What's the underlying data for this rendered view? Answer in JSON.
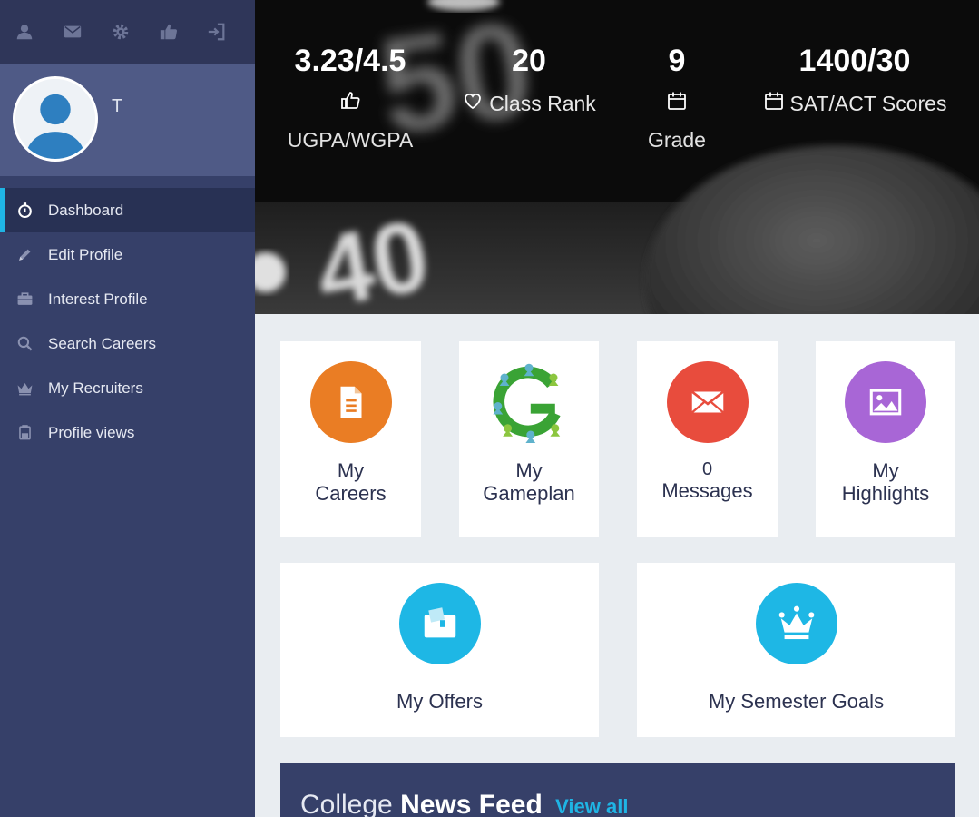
{
  "sidebar": {
    "top_icons": [
      "user-icon",
      "mail-icon",
      "gear-icon",
      "thumbs-up-icon",
      "sign-in-icon"
    ],
    "profile_name": "T",
    "items": [
      {
        "label": "Dashboard",
        "icon": "stopwatch-icon",
        "active": true
      },
      {
        "label": "Edit Profile",
        "icon": "pencil-icon",
        "active": false
      },
      {
        "label": "Interest Profile",
        "icon": "briefcase-icon",
        "active": false
      },
      {
        "label": "Search Careers",
        "icon": "search-icon",
        "active": false
      },
      {
        "label": "My Recruiters",
        "icon": "crown-icon",
        "active": false
      },
      {
        "label": "Profile views",
        "icon": "hourglass-icon",
        "active": false
      }
    ]
  },
  "stats": [
    {
      "value": "3.23/4.5",
      "label": "",
      "sublabel": "UGPA/WGPA",
      "icon": "thumbs-up-icon"
    },
    {
      "value": "20",
      "label": "Class Rank",
      "sublabel": "",
      "icon": "heart-icon"
    },
    {
      "value": "9",
      "label": "",
      "sublabel": "Grade",
      "icon": "calendar-icon"
    },
    {
      "value": "1400/30",
      "label": "SAT/ACT Scores",
      "sublabel": "",
      "icon": "calendar-icon"
    }
  ],
  "cards": {
    "careers": {
      "line1": "My",
      "line2": "Careers",
      "icon": "document-icon",
      "color": "#ea7d24"
    },
    "gameplan": {
      "line1": "My",
      "line2": "Gameplan",
      "icon": "gameplan-logo"
    },
    "messages": {
      "count": "0",
      "label": "Messages",
      "icon": "envelope-icon",
      "color": "#e84c3d"
    },
    "highlights": {
      "line1": "My",
      "line2": "Highlights",
      "icon": "image-icon",
      "color": "#a866d6"
    },
    "offers": {
      "label": "My Offers",
      "icon": "offer-icon",
      "color": "#1eb7e5"
    },
    "goals": {
      "label": "My Semester Goals",
      "icon": "crown-icon",
      "color": "#1eb7e5"
    }
  },
  "news": {
    "title_light": "College",
    "title_bold": "News Feed",
    "link": "View all"
  },
  "colors": {
    "sidebar": "#364069",
    "sidebar_dark": "#2f3659",
    "profile_band": "#4f5a86",
    "accent": "#1fb4e4"
  }
}
